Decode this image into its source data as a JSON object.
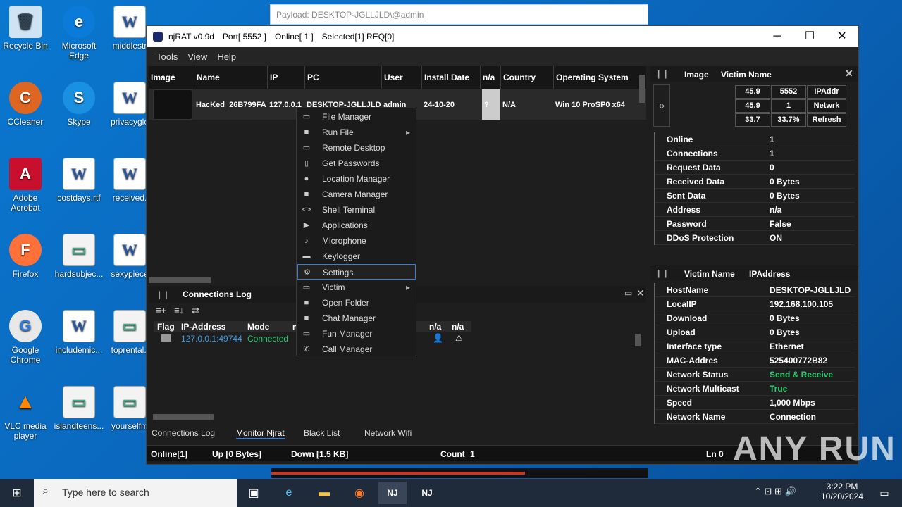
{
  "desktop": {
    "icons": [
      {
        "label": "Recycle Bin",
        "glyph": "🗑"
      },
      {
        "label": "Microsoft Edge",
        "glyph": "e"
      },
      {
        "label": "middlestr",
        "glyph": "W"
      },
      {
        "label": "CCleaner",
        "glyph": "C"
      },
      {
        "label": "Skype",
        "glyph": "S"
      },
      {
        "label": "privacyglo",
        "glyph": "W"
      },
      {
        "label": "Adobe Acrobat",
        "glyph": "A"
      },
      {
        "label": "costdays.rtf",
        "glyph": "W"
      },
      {
        "label": "received.",
        "glyph": "W"
      },
      {
        "label": "Firefox",
        "glyph": "F"
      },
      {
        "label": "hardsubjec...",
        "glyph": "▭"
      },
      {
        "label": "sexypiece",
        "glyph": "W"
      },
      {
        "label": "Google Chrome",
        "glyph": "G"
      },
      {
        "label": "includemic...",
        "glyph": "W"
      },
      {
        "label": "toprental.j",
        "glyph": "▭"
      },
      {
        "label": "VLC media player",
        "glyph": "▲"
      },
      {
        "label": "islandteens...",
        "glyph": "▭"
      },
      {
        "label": "yourselfm",
        "glyph": "▭"
      }
    ]
  },
  "payload": "Payload: DESKTOP-JGLLJLD\\@admin",
  "window": {
    "app": "njRAT v0.9d",
    "port": "Port[ 5552 ]",
    "online": "Online[ 1 ]",
    "selected": "Selected[1] REQ[0]",
    "minimize": "─",
    "maximize": "☐",
    "close": "✕"
  },
  "menu": [
    "Tools",
    "View",
    "Help"
  ],
  "grid": {
    "headers": [
      "Image",
      "Name",
      "IP",
      "PC",
      "User",
      "Install Date",
      "n/a",
      "Country",
      "Operating System"
    ],
    "row": {
      "name": "HacKed_26B799FA",
      "ip": "127.0.0.1",
      "pc": "DESKTOP-JGLLJLD",
      "user": "admin",
      "date": "24-10-20",
      "na": "?",
      "country": "N/A",
      "os": "Win 10 ProSP0 x64"
    }
  },
  "context_menu": [
    {
      "label": "File Manager",
      "icon": "▭"
    },
    {
      "label": "Run File",
      "icon": "■",
      "sub": "▸"
    },
    {
      "label": "Remote Desktop",
      "icon": "▭"
    },
    {
      "label": "Get Passwords",
      "icon": "▯"
    },
    {
      "label": "Location Manager",
      "icon": "●"
    },
    {
      "label": "Camera Manager",
      "icon": "■"
    },
    {
      "label": "Shell Terminal",
      "icon": "<>"
    },
    {
      "label": "Applications",
      "icon": "▶"
    },
    {
      "label": "Microphone",
      "icon": "♪"
    },
    {
      "label": "Keylogger",
      "icon": "▬"
    },
    {
      "label": "Settings",
      "icon": "⚙"
    },
    {
      "label": "Victim",
      "icon": "▭",
      "sub": "▸"
    },
    {
      "label": "Open Folder",
      "icon": "■"
    },
    {
      "label": "Chat  Manager",
      "icon": "■"
    },
    {
      "label": "Fun  Manager",
      "icon": "▭"
    },
    {
      "label": "Call  Manager",
      "icon": "✆"
    }
  ],
  "right": {
    "head1": {
      "a": "Image",
      "b": "Victim Name"
    },
    "stats": [
      [
        "45.9",
        "5552",
        "IPAddr"
      ],
      [
        "45.9",
        "1",
        "Netwrk"
      ],
      [
        "33.7",
        "33.7%",
        "Refresh"
      ]
    ],
    "rows1": [
      [
        "Online",
        "1"
      ],
      [
        "Connections",
        "1"
      ],
      [
        "Request Data",
        "0"
      ],
      [
        "Received Data",
        "0 Bytes"
      ],
      [
        "Sent Data",
        "0 Bytes"
      ],
      [
        "Address",
        "n/a"
      ],
      [
        "Password",
        "False"
      ],
      [
        "DDoS Protection",
        "ON"
      ]
    ],
    "head2": {
      "a": "Victim Name",
      "b": "IPAddress"
    },
    "rows2": [
      [
        "HostName",
        "DESKTOP-JGLLJLD"
      ],
      [
        "LocalIP",
        "192.168.100.105"
      ],
      [
        "Download",
        "0 Bytes"
      ],
      [
        "Upload",
        "0 Bytes"
      ],
      [
        "Interface type",
        "Ethernet"
      ],
      [
        "MAC-Addres",
        "525400772B82"
      ],
      [
        "Network Status",
        "Send & Receive"
      ],
      [
        "Network Multicast",
        "True"
      ],
      [
        "Speed",
        "1,000 Mbps"
      ],
      [
        "Network Name",
        "Connection"
      ]
    ]
  },
  "log": {
    "title": "Connections Log",
    "headers": [
      "Flag",
      "IP-Address",
      "Mode",
      "n",
      "n/a",
      "n/a"
    ],
    "ip": "127.0.0.1:49744",
    "mode": "Connected"
  },
  "tabs": [
    "Connections Log",
    "Monitor Njrat",
    "Black List",
    "Network Wifi"
  ],
  "status": {
    "online": "Online[1]",
    "up": "Up [0 Bytes]",
    "down": "Down [1.5 KB]",
    "count_label": "Count",
    "count": "1",
    "ln": "Ln  0"
  },
  "taskbar": {
    "search": "Type here to search",
    "time": "3:22 PM",
    "date": "10/20/2024"
  },
  "watermark": "ANY RUN",
  "colors": {
    "green": "#2ecc71",
    "link": "#3aa0e8"
  }
}
